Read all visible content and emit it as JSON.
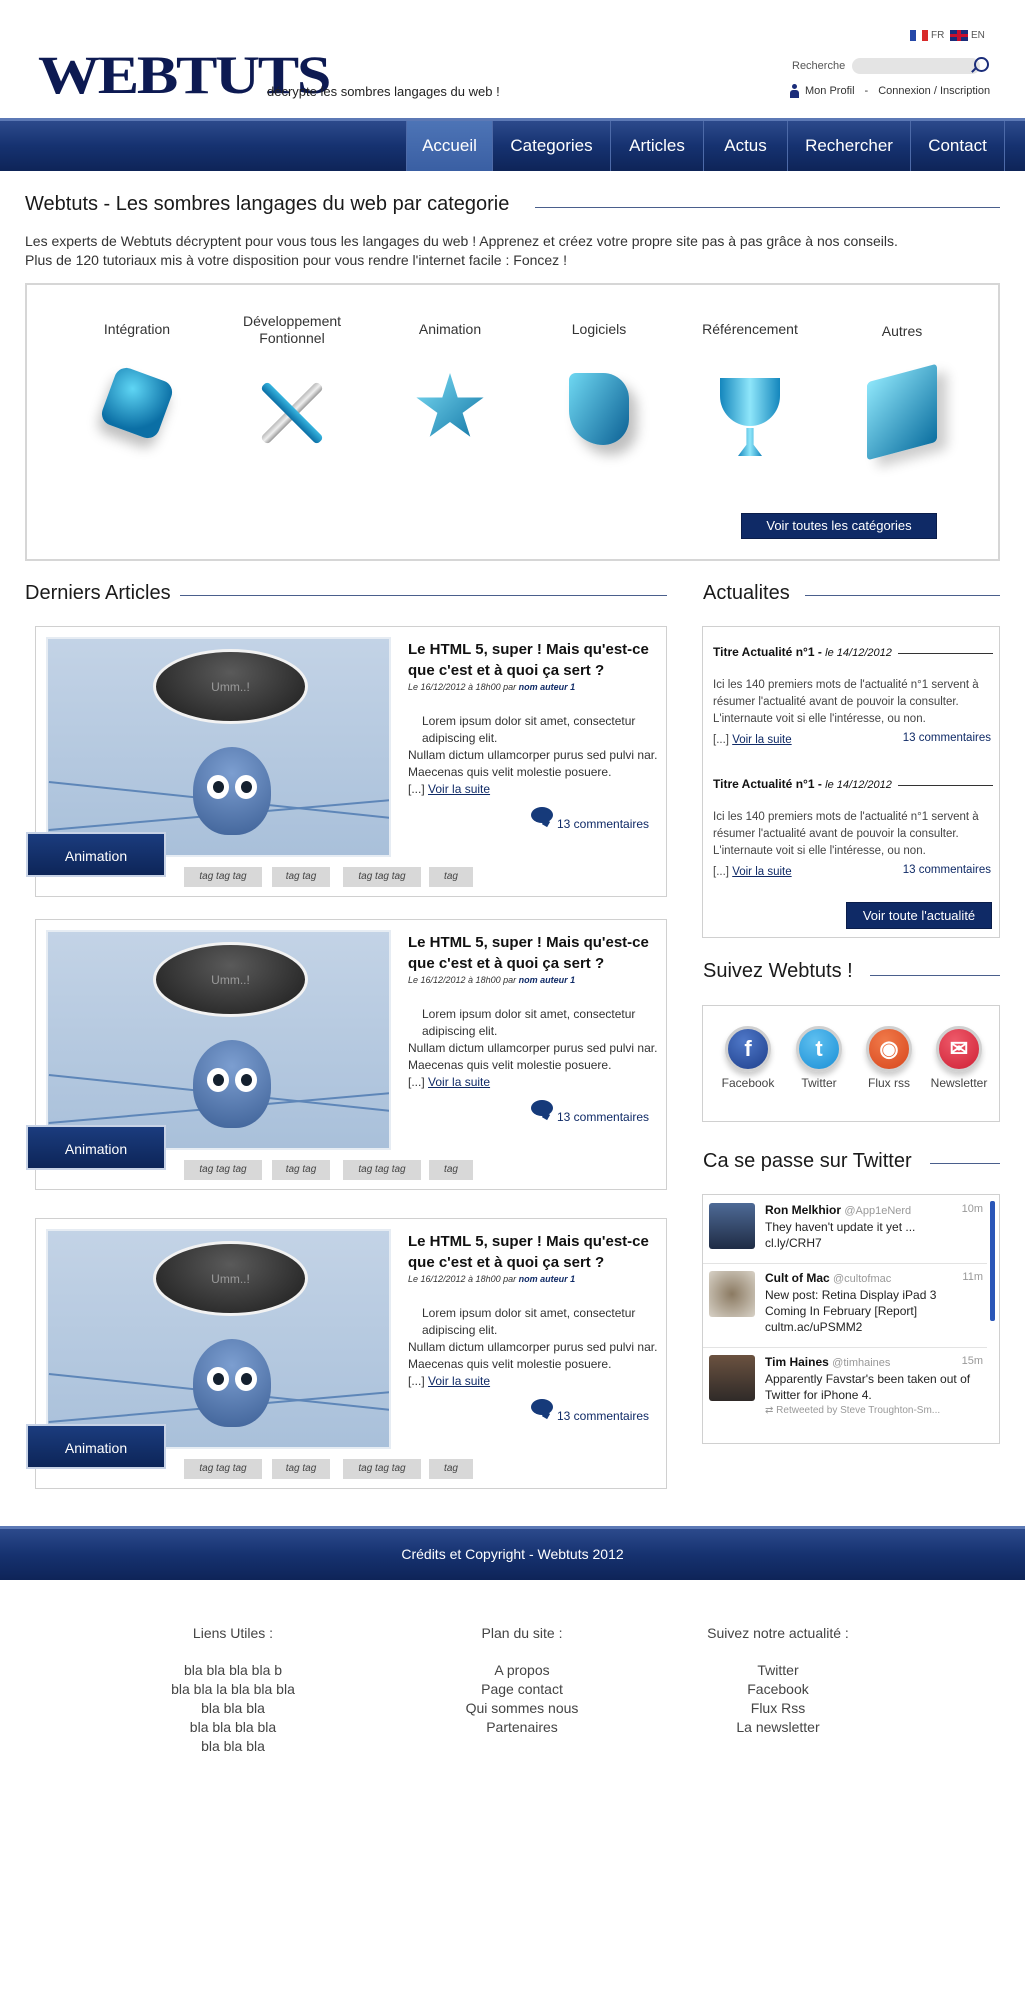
{
  "header": {
    "logo": "WEBTUTS",
    "tagline": "décrypte les sombres langages du web !",
    "lang_fr": "FR",
    "lang_en": "EN",
    "search_label": "Recherche",
    "search_placeholder": "",
    "profile": "Mon Profil",
    "separator": "-",
    "login": "Connexion / Inscription"
  },
  "nav": [
    "Accueil",
    "Categories",
    "Articles",
    "Actus",
    "Rechercher",
    "Contact"
  ],
  "intro": {
    "title": "Webtuts - Les sombres langages du web par categorie",
    "line1": "Les experts de Webtuts décryptent pour vous tous les langages du web ! Apprenez et créez votre propre site pas à pas grâce à nos conseils.",
    "line2": "Plus  de 120 tutoriaux mis à votre disposition pour vous rendre l'internet facile  : Foncez !"
  },
  "categories": {
    "items": [
      "Intégration",
      "Développement Fontionnel",
      "Animation",
      "Logiciels",
      "Référencement",
      "Autres"
    ],
    "button": "Voir toutes les catégories"
  },
  "articles": {
    "section_title": "Derniers Articles",
    "bubble": "Umm..!",
    "items": [
      {
        "title": "Le HTML 5, super ! Mais qu'est-ce que c'est et à quoi ça sert ?",
        "meta": "Le 16/12/2012 à 18h00 par",
        "author": "nom auteur 1",
        "text1": "Lorem ipsum dolor sit amet, consectetur adipiscing elit.",
        "text2": "Nullam dictum ullamcorper purus sed pulvi nar. Maecenas quis velit molestie posuere.",
        "ellipsis": "[...]",
        "more": "Voir la suite",
        "comments": "13 commentaires",
        "badge": "Animation",
        "tags": [
          "tag tag tag",
          "tag tag",
          "tag tag tag",
          "tag"
        ]
      },
      {
        "title": "Le HTML 5, super ! Mais qu'est-ce que c'est et à quoi ça sert ?",
        "meta": "Le 16/12/2012 à 18h00 par",
        "author": "nom auteur 1",
        "text1": "Lorem ipsum dolor sit amet, consectetur adipiscing elit.",
        "text2": "Nullam dictum ullamcorper purus sed pulvi nar. Maecenas quis velit molestie posuere.",
        "ellipsis": "[...]",
        "more": "Voir la suite",
        "comments": "13 commentaires",
        "badge": "Animation",
        "tags": [
          "tag tag tag",
          "tag tag",
          "tag tag tag",
          "tag"
        ]
      },
      {
        "title": "Le HTML 5, super ! Mais qu'est-ce que c'est et à quoi ça sert ?",
        "meta": "Le 16/12/2012 à 18h00 par",
        "author": "nom auteur 1",
        "text1": "Lorem ipsum dolor sit amet, consectetur adipiscing elit.",
        "text2": "Nullam dictum ullamcorper purus sed pulvi nar. Maecenas quis velit molestie posuere.",
        "ellipsis": "[...]",
        "more": "Voir la suite",
        "comments": "13 commentaires",
        "badge": "Animation",
        "tags": [
          "tag tag tag",
          "tag tag",
          "tag tag tag",
          "tag"
        ]
      }
    ]
  },
  "news": {
    "section_title": "Actualites",
    "items": [
      {
        "title": "Titre Actualité n°1 -",
        "date": "le 14/12/2012",
        "text": "Ici les 140 premiers mots de l'actualité n°1 servent à résumer l'actualité avant de pouvoir la consulter. L'internaute voit si elle l'intéresse, ou non.",
        "ellipsis": "[...]",
        "more": "Voir la suite",
        "comments": "13 commentaires"
      },
      {
        "title": "Titre Actualité n°1 -",
        "date": "le 14/12/2012",
        "text": "Ici les 140 premiers mots de l'actualité n°1 servent à résumer l'actualité avant de pouvoir la consulter. L'internaute voit si elle l'intéresse, ou non.",
        "ellipsis": "[...]",
        "more": "Voir la suite",
        "comments": "13 commentaires"
      }
    ],
    "button": "Voir toute l'actualité"
  },
  "follow": {
    "section_title": "Suivez Webtuts !",
    "items": [
      {
        "label": "Facebook",
        "icon": "facebook-icon",
        "glyph": "f",
        "color": "#1e3f8c"
      },
      {
        "label": "Twitter",
        "icon": "twitter-icon",
        "glyph": "t",
        "color": "#1a8fd6"
      },
      {
        "label": "Flux rss",
        "icon": "rss-icon",
        "glyph": "◉",
        "color": "#d8461c"
      },
      {
        "label": "Newsletter",
        "icon": "newsletter-icon",
        "glyph": "✉",
        "color": "#cf2035"
      }
    ]
  },
  "twitter": {
    "section_title": "Ca se passe sur Twitter",
    "tweets": [
      {
        "name": "Ron Melkhior",
        "handle": "@App1eNerd",
        "time": "10m",
        "text": "They haven't update it yet ... cl.ly/CRH7"
      },
      {
        "name": "Cult of Mac",
        "handle": "@cultofmac",
        "time": "11m",
        "text": "New post: Retina Display iPad 3 Coming In February [Report] cultm.ac/uPSMM2"
      },
      {
        "name": "Tim Haines",
        "handle": "@timhaines",
        "time": "15m",
        "text": "Apparently Favstar's been taken out of Twitter for iPhone 4."
      }
    ],
    "retweet_note": "Retweeted by Steve Troughton-Sm..."
  },
  "footer": {
    "copyright": "Crédits et Copyright - Webtuts 2012",
    "col1": {
      "title": "Liens Utiles  :",
      "items": [
        "bla bla bla bla b",
        "bla bla la bla bla bla",
        "bla bla bla",
        "bla bla bla bla",
        "bla bla bla"
      ]
    },
    "col2": {
      "title": "Plan du site :",
      "items": [
        "A propos",
        "Page contact",
        "Qui sommes nous",
        "Partenaires"
      ]
    },
    "col3": {
      "title": "Suivez notre actualité  :",
      "items": [
        "Twitter",
        "Facebook",
        "Flux Rss",
        "La newsletter"
      ]
    }
  }
}
